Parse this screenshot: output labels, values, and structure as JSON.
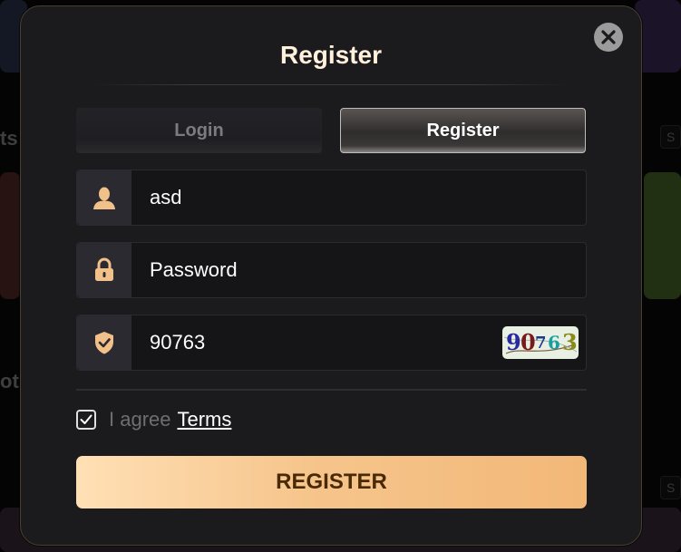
{
  "modal": {
    "title": "Register",
    "close_icon": "close-icon"
  },
  "tabs": [
    {
      "label": "Login",
      "active": false
    },
    {
      "label": "Register",
      "active": true
    }
  ],
  "fields": {
    "username": {
      "icon": "user-icon",
      "value": "asd"
    },
    "password": {
      "icon": "lock-icon",
      "value": "Password"
    },
    "captcha": {
      "icon": "shield-icon",
      "value": "90763",
      "image_digits": [
        "9",
        "0",
        "7",
        "6",
        "3"
      ]
    }
  },
  "agree": {
    "checked": true,
    "text": "I agree",
    "link": "Terms"
  },
  "submit_label": "REGISTER",
  "background": {
    "edge_left_1": "ts",
    "edge_left_2": "ots",
    "pill_1": "S",
    "pill_2": "S"
  },
  "colors": {
    "accent_start": "#ffe0b5",
    "accent_end": "#f2b878",
    "button_text": "#4a2a05",
    "icon_color": "#f2c089",
    "title": "#fff1dc"
  }
}
